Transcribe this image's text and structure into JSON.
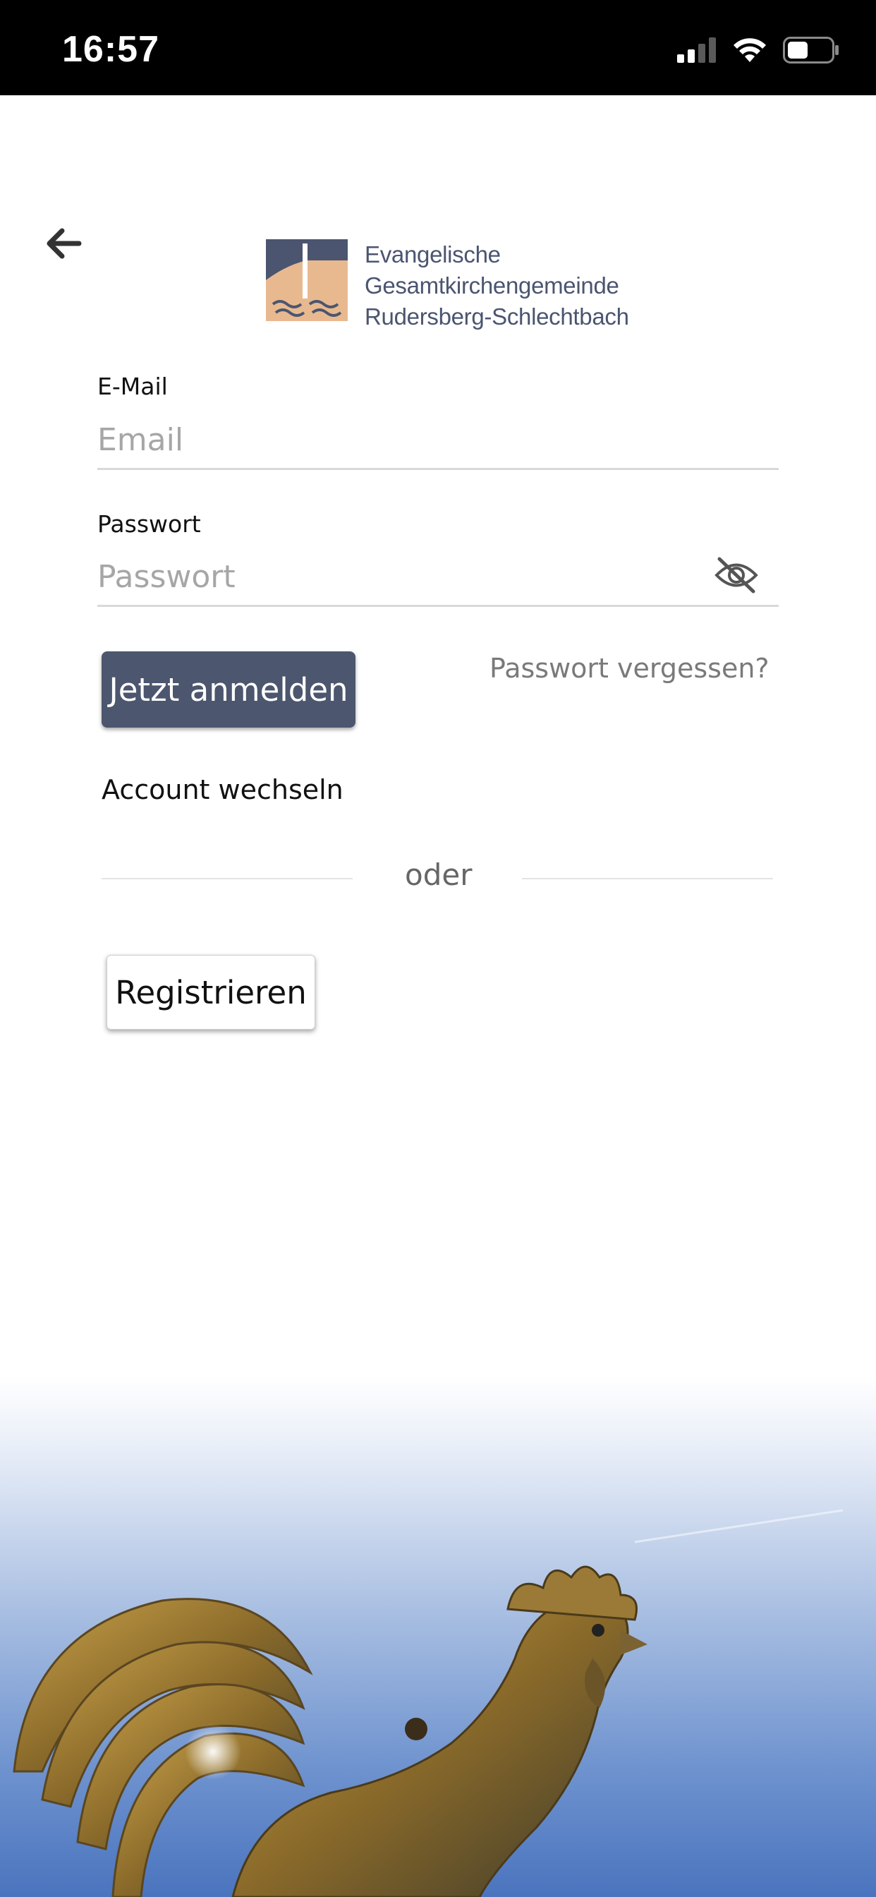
{
  "status_bar": {
    "time": "16:57"
  },
  "header": {
    "back_icon": "arrow-left-icon",
    "logo_lines": [
      "Evangelische",
      "Gesamtkirchengemeinde",
      "Rudersberg-Schlechtbach"
    ]
  },
  "login_form": {
    "email_label": "E-Mail",
    "email_placeholder": "Email",
    "password_label": "Passwort",
    "password_placeholder": "Passwort",
    "password_toggle_icon": "eye-slash-icon",
    "submit_label": "Jetzt anmelden",
    "forgot_label": "Passwort vergessen?",
    "switch_account_label": "Account wechseln",
    "divider_label": "oder",
    "register_label": "Registrieren"
  },
  "colors": {
    "primary_button": "#4c566e",
    "logo_blue": "#4b5570",
    "logo_sand": "#e8b98f",
    "sky": "#4a74be"
  }
}
